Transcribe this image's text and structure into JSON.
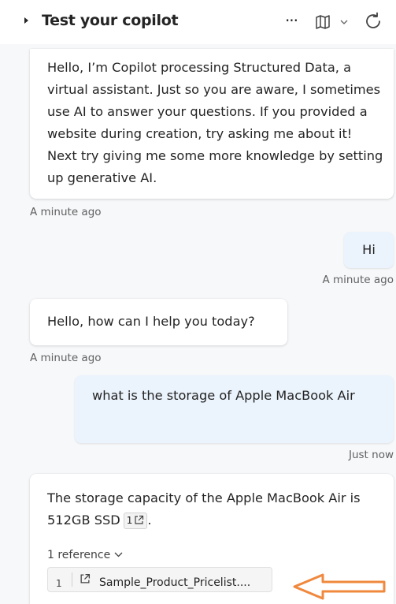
{
  "header": {
    "title": "Test your copilot",
    "more_label": "···"
  },
  "messages": [
    {
      "role": "bot",
      "text": "Hello, I’m Copilot processing Structured Data, a virtual assistant. Just so you are aware, I sometimes use AI to answer your questions. If you provided a website during creation, try asking me about it! Next try giving me some more knowledge by setting up generative AI.",
      "timestamp": "A minute ago"
    },
    {
      "role": "user",
      "text": "Hi",
      "timestamp": "A minute ago"
    },
    {
      "role": "bot",
      "text": "Hello, how can I help you today?",
      "timestamp": "A minute ago"
    },
    {
      "role": "user",
      "text": "what is the storage of Apple MacBook Air",
      "timestamp": "Just now"
    },
    {
      "role": "bot",
      "text": "The storage capacity of the Apple MacBook Air is 512GB SSD",
      "citation_number": "1",
      "trailing": ".",
      "references_label": "1 reference",
      "references": [
        {
          "number": "1",
          "label": "Sample_Product_Pricelist...."
        }
      ]
    }
  ],
  "colors": {
    "background": "#f7f8fa",
    "bot_bubble": "#ffffff",
    "user_bubble": "#ebf3fc",
    "annotation_arrow": "#f0883e"
  },
  "icons": [
    "caret-right-icon",
    "more-icon",
    "map-icon",
    "chevron-down-icon",
    "refresh-icon",
    "external-link-icon",
    "annotation-arrow"
  ]
}
